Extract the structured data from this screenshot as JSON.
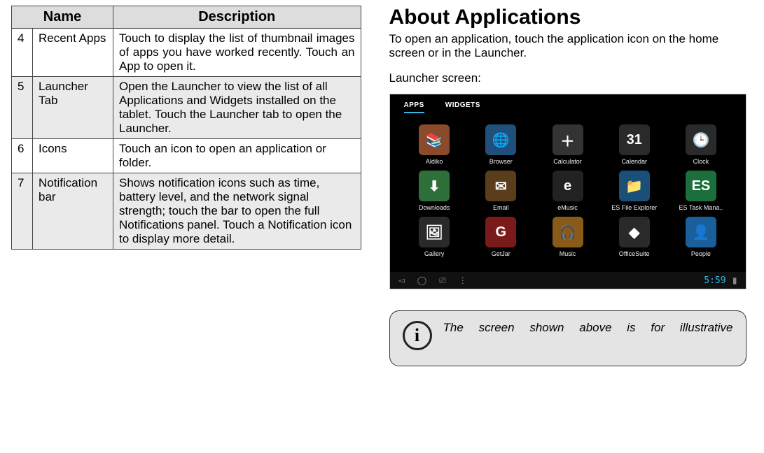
{
  "table": {
    "headers": [
      "Name",
      "Description"
    ],
    "rows": [
      {
        "num": "4",
        "name": "Recent Apps",
        "desc": "Touch to display the list of thumbnail images of apps you have worked recently. Touch an App to open it."
      },
      {
        "num": "5",
        "name": "Launcher Tab",
        "desc": "Open the Launcher to view the list of all Applications and Widgets installed on the tablet. Touch the Launcher tab to open the Launcher."
      },
      {
        "num": "6",
        "name": "Icons",
        "desc": "Touch an icon to open an application or folder."
      },
      {
        "num": "7",
        "name": "Notification bar",
        "desc": "Shows notification icons such as time, battery level, and the network signal strength; touch the bar to open the full Notifications panel. Touch a Notification icon to display more detail."
      }
    ]
  },
  "right": {
    "heading": "About Applications",
    "para": "To open an application, touch the application icon on the home screen or in the Launcher.",
    "launcher_label": "Launcher screen:",
    "tabs": {
      "apps": "APPS",
      "widgets": "WIDGETS"
    },
    "apps": [
      {
        "label": "Aldiko",
        "bg": "#8b4a2b",
        "glyph": "📚"
      },
      {
        "label": "Browser",
        "bg": "#1f4f7a",
        "glyph": "🌐"
      },
      {
        "label": "Calculator",
        "bg": "#333333",
        "glyph": "＋"
      },
      {
        "label": "Calendar",
        "bg": "#2a2a2a",
        "glyph": "31"
      },
      {
        "label": "Clock",
        "bg": "#2a2a2a",
        "glyph": "🕒"
      },
      {
        "label": "Downloads",
        "bg": "#2f6f3a",
        "glyph": "⬇"
      },
      {
        "label": "Email",
        "bg": "#5a3d1a",
        "glyph": "✉"
      },
      {
        "label": "eMusic",
        "bg": "#222222",
        "glyph": "e"
      },
      {
        "label": "ES File Explorer",
        "bg": "#1a4f7a",
        "glyph": "📁"
      },
      {
        "label": "ES Task Mana..",
        "bg": "#1a6f3a",
        "glyph": "ES"
      },
      {
        "label": "Gallery",
        "bg": "#2a2a2a",
        "glyph": "🖼"
      },
      {
        "label": "GetJar",
        "bg": "#7a1a1a",
        "glyph": "G"
      },
      {
        "label": "Music",
        "bg": "#8a5a1a",
        "glyph": "🎧"
      },
      {
        "label": "OfficeSuite",
        "bg": "#2a2a2a",
        "glyph": "◆"
      },
      {
        "label": "People",
        "bg": "#1a5f9a",
        "glyph": "👤"
      }
    ],
    "nav": {
      "back": "◅",
      "home": "◯",
      "recent": "⎚",
      "menu": "⋮",
      "clock": "5:59",
      "battery": "▮"
    },
    "note": "The screen shown above is for illustrative"
  }
}
